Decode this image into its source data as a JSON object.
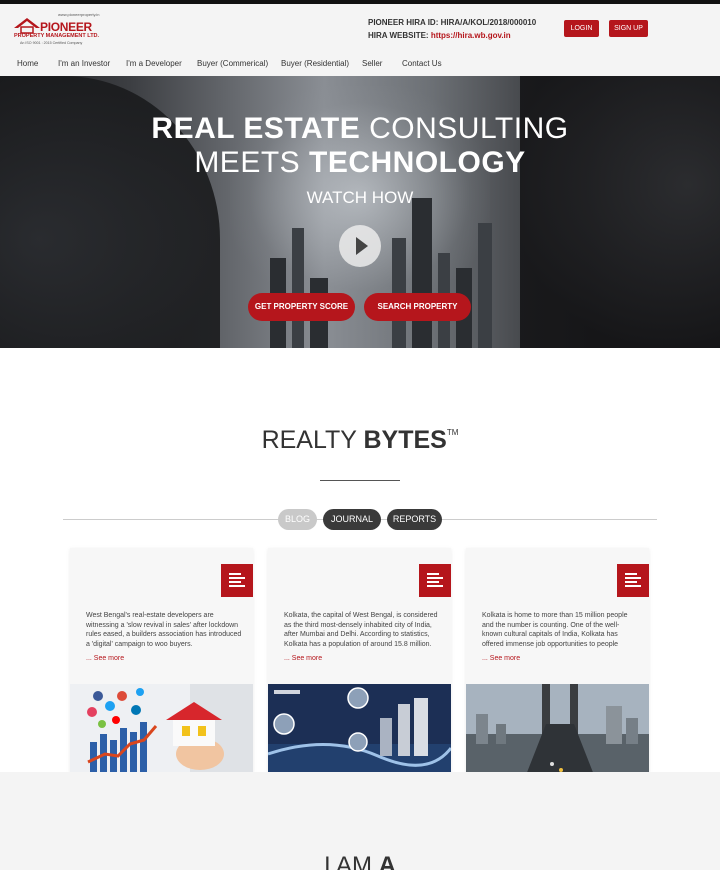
{
  "logo": {
    "website_tiny": "www.pioneerproperty.in",
    "name": "PIONEER",
    "subtitle": "PROPERTY MANAGEMENT LTD.",
    "cert": "An ISO 9001 : 2015 Certified Company"
  },
  "hira": {
    "id_label": "PIONEER HIRA ID: HIRA/A/KOL/2018/000010",
    "website_label": "HIRA WEBSITE: ",
    "website_link": "https://hira.wb.gov.in"
  },
  "auth": {
    "login": "LOGIN",
    "signup": "SIGN UP"
  },
  "nav": [
    "Home",
    "I'm an Investor",
    "I'm a Developer",
    "Buyer (Commerical)",
    "Buyer (Residential)",
    "Seller",
    "Contact Us"
  ],
  "hero": {
    "line1_bold": "REAL ESTATE",
    "line1_thin": " CONSULTING",
    "line2_thin": "MEETS ",
    "line2_bold": "TECHNOLOGY",
    "watch": "WATCH HOW",
    "btn_score": "GET PROPERTY SCORE",
    "btn_search": "SEARCH PROPERTY"
  },
  "realty": {
    "title_thin": "REALTY ",
    "title_bold": "BYTES",
    "tm": "TM",
    "tabs": [
      "BLOG",
      "JOURNAL",
      "REPORTS"
    ]
  },
  "cards": [
    {
      "text": "West Bengal's real-estate developers are witnessing a 'slow revival in sales' after lockdown rules eased, a builders association has introduced a 'digital' campaign to woo buyers.",
      "more": "... See more"
    },
    {
      "text": "Kolkata, the capital of West Bengal, is considered as the third most-densely inhabited city of India, after Mumbai and Delhi. According to statistics, Kolkata has a population of around 15.8 million.",
      "more": "... See more"
    },
    {
      "text": "Kolkata is home to more than 15 million people and the number is counting. One of the well-known cultural capitals of India, Kolkata has offered immense job opportunities to people",
      "more": "... See more"
    }
  ],
  "iam": {
    "thin": "I AM ",
    "bold": "A"
  },
  "colors": {
    "accent": "#b5161c",
    "pill_dark": "#3a3a3a",
    "pill_light": "#c9c9c9"
  }
}
